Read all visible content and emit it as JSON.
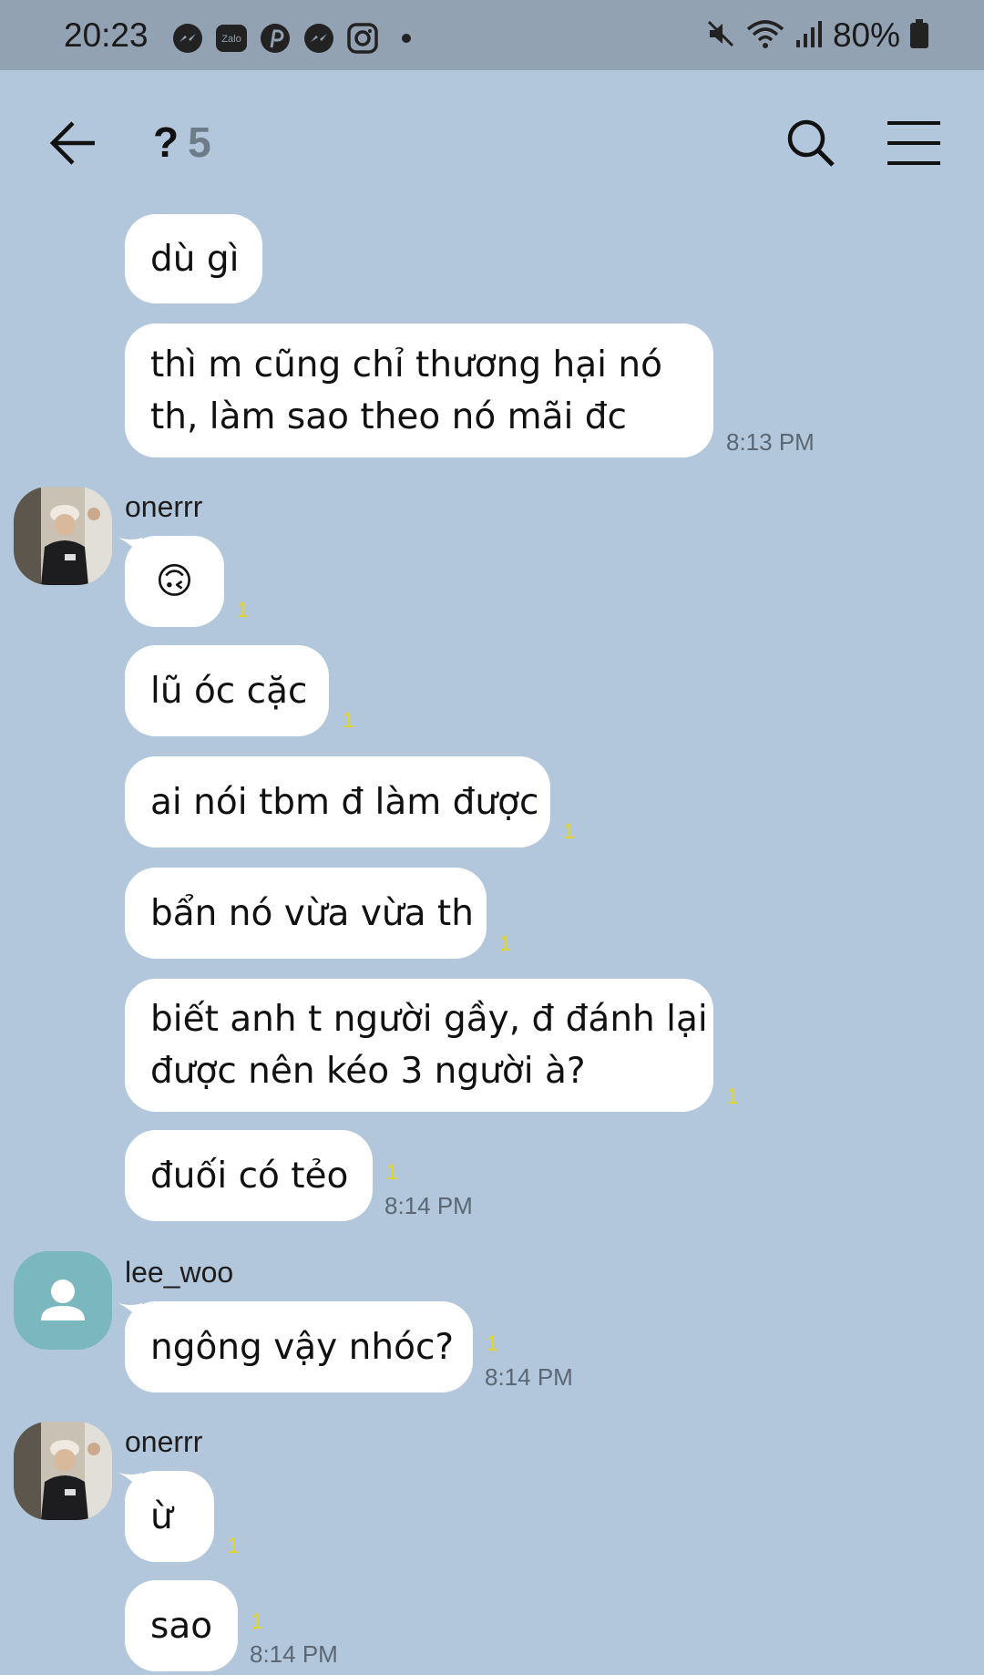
{
  "status_bar": {
    "time": "20:23",
    "notification_icons": [
      "messenger-icon",
      "zalo-icon",
      "pinterest-icon",
      "messenger-icon",
      "instagram-icon"
    ],
    "zalo_text": "Zalo",
    "battery": "80%"
  },
  "header": {
    "title": "?",
    "member_count": "5"
  },
  "messages": {
    "m1": {
      "text": "dù gì"
    },
    "m2": {
      "line1": "thì m cũng chỉ thương hại nó",
      "line2": "th, làm sao theo nó mãi đc",
      "time": "8:13 PM"
    },
    "g1_sender": "onerrr",
    "m3": {
      "text": "🙃",
      "unread": "1"
    },
    "m4": {
      "text": "lũ óc cặc",
      "unread": "1"
    },
    "m5": {
      "text": "ai nói tbm đ làm được",
      "unread": "1"
    },
    "m6": {
      "text": "bẩn nó vừa vừa th",
      "unread": "1"
    },
    "m7": {
      "line1": "biết anh t người gầy, đ đánh lại",
      "line2": "được nên kéo 3 người à?",
      "unread": "1"
    },
    "m8": {
      "text": "đuối có tẻo",
      "unread": "1",
      "time": "8:14 PM"
    },
    "g2_sender": "lee_woo",
    "m9": {
      "text": "ngông vậy nhóc?",
      "unread": "1",
      "time": "8:14 PM"
    },
    "g3_sender": "onerrr",
    "m10": {
      "text": "ừ",
      "unread": "1"
    },
    "m11": {
      "text": "sao",
      "unread": "1",
      "time": "8:14 PM"
    }
  },
  "colors": {
    "background": "#b3c7dc",
    "status_bar": "#93a2b2",
    "bubble": "#ffffff",
    "unread": "#e5d428",
    "default_avatar": "#7ab7bf"
  }
}
